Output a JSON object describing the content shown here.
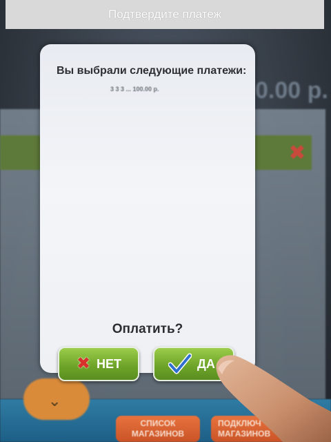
{
  "header": {
    "title": "Подтвердите платеж"
  },
  "background": {
    "amount_fragment": "0.00 р.",
    "bottom_buttons": [
      {
        "label_line1": "СПИСОК",
        "label_line2": "МАГАЗИНОВ"
      },
      {
        "label_line1": "ПОДКЛЮЧ",
        "label_line2": "МАГАЗИНОВ"
      }
    ]
  },
  "dialog": {
    "title": "Вы выбрали следующие платежи:",
    "payment_line": "3 3 3 ...   100.00 р.",
    "question": "Оплатить?",
    "no_label": "НЕТ",
    "yes_label": "ДА"
  },
  "icons": {
    "no": "cross-icon",
    "yes": "check-icon",
    "background_close": "close-icon",
    "background_expand": "chevron-down-icon"
  }
}
